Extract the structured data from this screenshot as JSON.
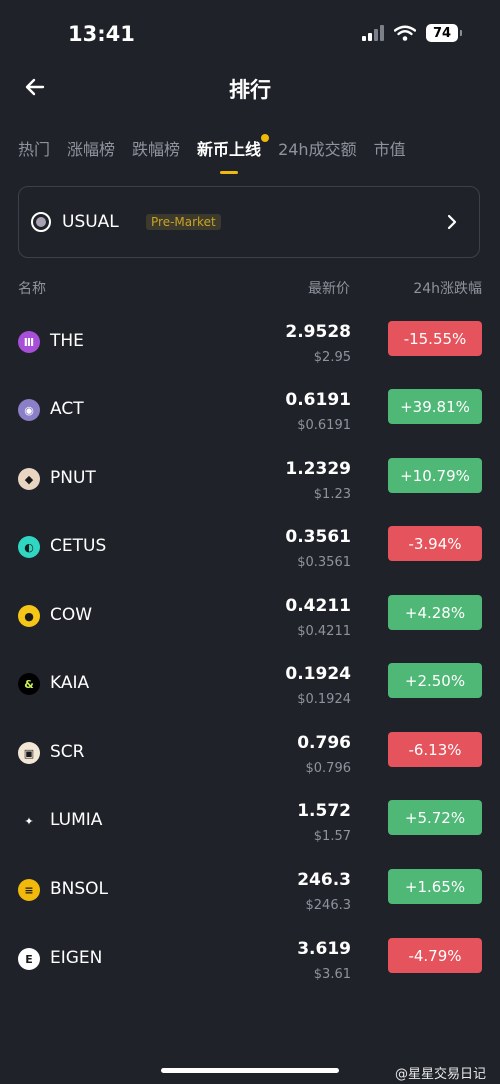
{
  "status_bar": {
    "time": "13:41",
    "battery": "74"
  },
  "header": {
    "title": "排行"
  },
  "tabs": [
    {
      "label": "热门",
      "active": false
    },
    {
      "label": "涨幅榜",
      "active": false
    },
    {
      "label": "跌幅榜",
      "active": false
    },
    {
      "label": "新币上线",
      "active": true
    },
    {
      "label": "24h成交额",
      "active": false
    },
    {
      "label": "市值",
      "active": false
    }
  ],
  "premarket": {
    "symbol": "USUAL",
    "badge": "Pre-Market"
  },
  "columns": {
    "name": "名称",
    "price": "最新价",
    "change": "24h涨跌幅"
  },
  "rows": [
    {
      "symbol": "THE",
      "price": "2.9528",
      "fiat": "$2.95",
      "change": "-15.55%",
      "direction": "down",
      "icon": "the-icon",
      "icon_color": "#a74fd8",
      "icon_glyph": "Ⅲ"
    },
    {
      "symbol": "ACT",
      "price": "0.6191",
      "fiat": "$0.6191",
      "change": "+39.81%",
      "direction": "up",
      "icon": "act-icon",
      "icon_color": "#8b7fc7",
      "icon_glyph": "◉"
    },
    {
      "symbol": "PNUT",
      "price": "1.2329",
      "fiat": "$1.23",
      "change": "+10.79%",
      "direction": "up",
      "icon": "pnut-icon",
      "icon_color": "#e8d6c3",
      "icon_glyph": "◆"
    },
    {
      "symbol": "CETUS",
      "price": "0.3561",
      "fiat": "$0.3561",
      "change": "-3.94%",
      "direction": "down",
      "icon": "cetus-icon",
      "icon_color": "#2fd6c2",
      "icon_glyph": "◐"
    },
    {
      "symbol": "COW",
      "price": "0.4211",
      "fiat": "$0.4211",
      "change": "+4.28%",
      "direction": "up",
      "icon": "cow-icon",
      "icon_color": "#f5c518",
      "icon_glyph": "●"
    },
    {
      "symbol": "KAIA",
      "price": "0.1924",
      "fiat": "$0.1924",
      "change": "+2.50%",
      "direction": "up",
      "icon": "kaia-icon",
      "icon_color": "#000000",
      "icon_glyph": "&"
    },
    {
      "symbol": "SCR",
      "price": "0.796",
      "fiat": "$0.796",
      "change": "-6.13%",
      "direction": "down",
      "icon": "scr-icon",
      "icon_color": "#f3e8d6",
      "icon_glyph": "▣"
    },
    {
      "symbol": "LUMIA",
      "price": "1.572",
      "fiat": "$1.57",
      "change": "+5.72%",
      "direction": "up",
      "icon": "lumia-icon",
      "icon_color": "#1f2229",
      "icon_glyph": "✦"
    },
    {
      "symbol": "BNSOL",
      "price": "246.3",
      "fiat": "$246.3",
      "change": "+1.65%",
      "direction": "up",
      "icon": "bnsol-icon",
      "icon_color": "#f0b90b",
      "icon_glyph": "≡"
    },
    {
      "symbol": "EIGEN",
      "price": "3.619",
      "fiat": "$3.61",
      "change": "-4.79%",
      "direction": "down",
      "icon": "eigen-icon",
      "icon_color": "#ffffff",
      "icon_glyph": "E"
    }
  ],
  "watermark": "@星星交易日记",
  "colors": {
    "up": "#4fb877",
    "down": "#e5535c",
    "accent": "#f0b90b",
    "background": "#1f2229"
  }
}
